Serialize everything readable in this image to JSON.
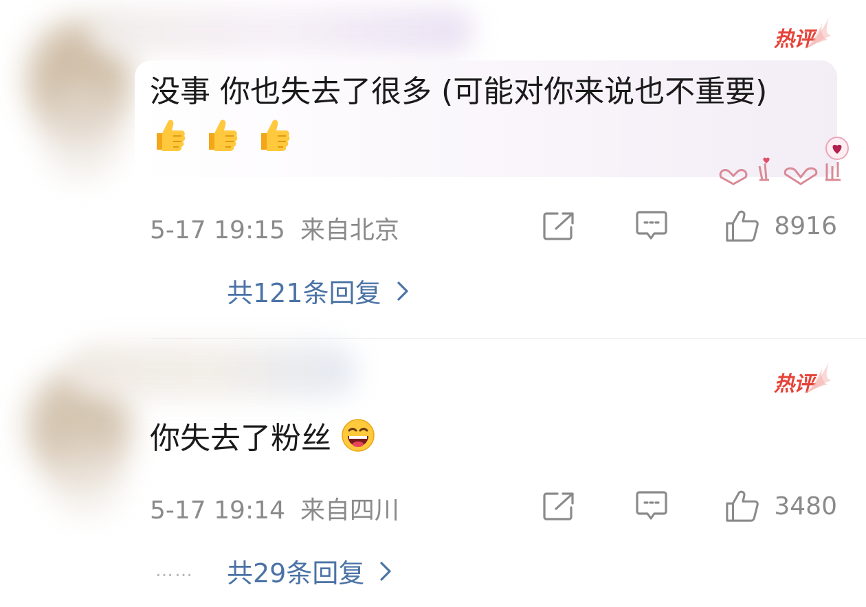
{
  "comments": [
    {
      "badge": "热评",
      "text": "没事 你也失去了很多 (可能对你来说也不重要)",
      "emoji": [
        "thumbs-up",
        "thumbs-up",
        "thumbs-up"
      ],
      "date": "5-17 19:15",
      "location": "来自北京",
      "likes": "8916",
      "replies": "共121条回复",
      "sticker": "heart-hands-sticker"
    },
    {
      "badge": "热评",
      "text": "你失去了粉丝",
      "emoji": [
        "laughing-face"
      ],
      "date": "5-17 19:14",
      "location": "来自四川",
      "likes": "3480",
      "replies": "共29条回复",
      "dots": "……"
    }
  ],
  "icons": {
    "share": "share-icon",
    "reply": "comment-icon",
    "like": "thumbs-up-icon",
    "chevron": "chevron-right-icon"
  },
  "colors": {
    "hot_badge": "#e6443a",
    "reply_link": "#4b73a6",
    "meta_text": "#8a8a8a",
    "body_text": "#1a1a1a"
  }
}
